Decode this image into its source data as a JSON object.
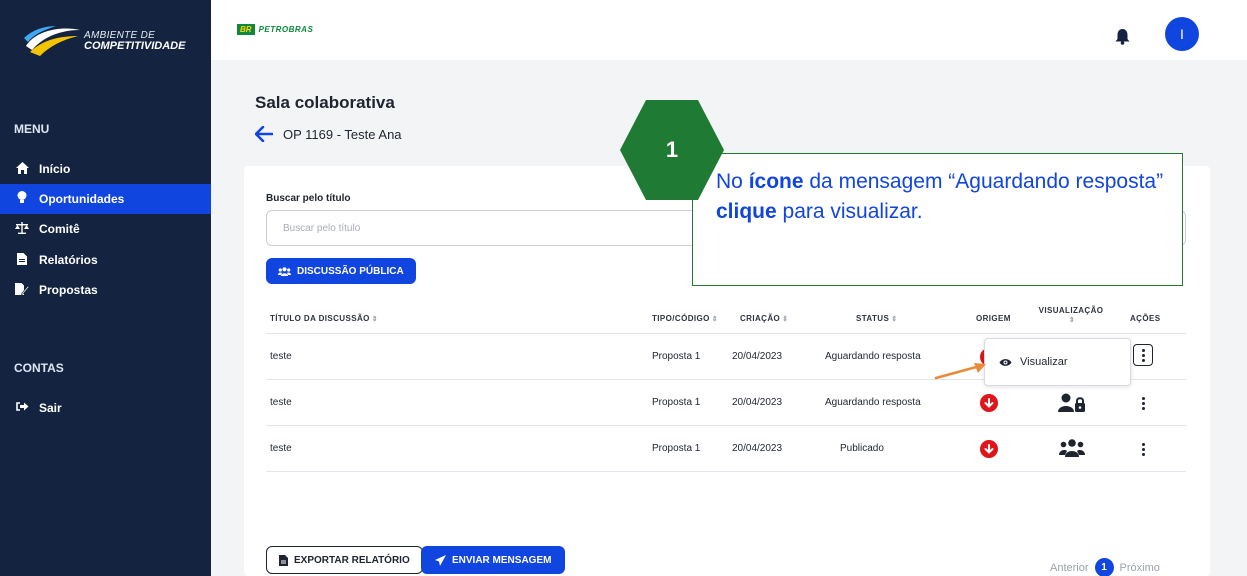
{
  "brand": {
    "line1": "AMBIENTE DE",
    "line2": "COMPETITIVIDADE",
    "partner_badge": "BR",
    "partner_name": "PETROBRAS"
  },
  "sidebar": {
    "menu_title": "MENU",
    "items": [
      {
        "label": "Início",
        "icon": "home-icon"
      },
      {
        "label": "Oportunidades",
        "icon": "lightbulb-icon"
      },
      {
        "label": "Comitê",
        "icon": "scale-icon"
      },
      {
        "label": "Relatórios",
        "icon": "file-icon"
      },
      {
        "label": "Propostas",
        "icon": "edit-file-icon"
      }
    ],
    "accounts_title": "CONTAS",
    "logout_label": "Sair"
  },
  "topbar": {
    "avatar_initial": "I"
  },
  "page": {
    "title": "Sala colaborativa",
    "back_label": "OP 1169 - Teste Ana"
  },
  "search": {
    "label": "Buscar pelo título",
    "placeholder": "Buscar pelo título"
  },
  "buttons": {
    "public_discussion": "DISCUSSÃO PÚBLICA",
    "export_report": "EXPORTAR RELATÓRIO",
    "send_message": "ENVIAR MENSAGEM"
  },
  "table": {
    "headers": {
      "title": "TÍTULO DA DISCUSSÃO",
      "type": "TIPO/CÓDIGO",
      "created": "CRIAÇÃO",
      "status": "STATUS",
      "origin": "ORIGEM",
      "visualization": "VISUALIZAÇÃO",
      "actions": "AÇÕES"
    },
    "rows": [
      {
        "title": "teste",
        "type": "Proposta 1",
        "created": "20/04/2023",
        "status": "Aguardando resposta"
      },
      {
        "title": "teste",
        "type": "Proposta 1",
        "created": "20/04/2023",
        "status": "Aguardando resposta"
      },
      {
        "title": "teste",
        "type": "Proposta 1",
        "created": "20/04/2023",
        "status": "Publicado"
      }
    ]
  },
  "popup": {
    "label": "Visualizar"
  },
  "pagination": {
    "prev": "Anterior",
    "current": "1",
    "next": "Próximo"
  },
  "callout": {
    "step": "1",
    "part1": "No ",
    "bold1": "ícone",
    "part2": " da mensagem “Aguardando resposta” ",
    "bold2": "clique",
    "part3": " para visualizar."
  },
  "colors": {
    "sidebar_bg": "#14233f",
    "primary": "#1145e0",
    "callout_green": "#1f7a34",
    "origin_red": "#e0151b",
    "arrow_orange": "#e98a3b"
  }
}
